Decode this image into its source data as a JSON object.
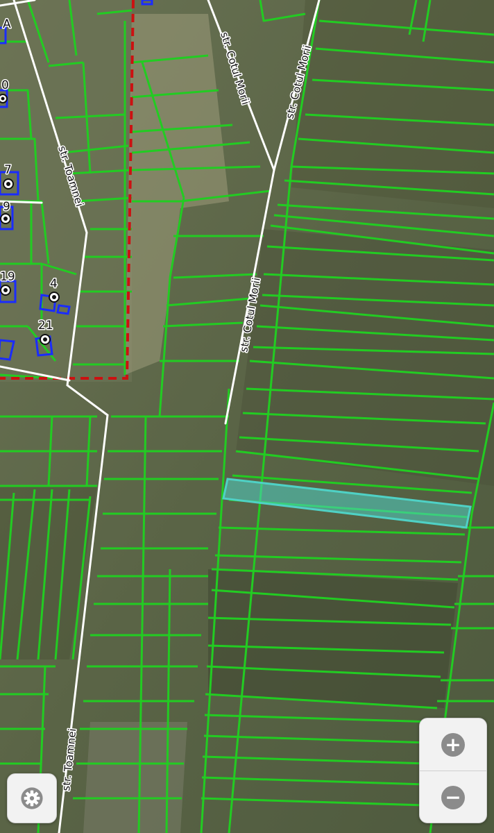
{
  "map": {
    "street_labels": {
      "toamnei_upper": "str. Toamnei",
      "toamnei_lower": "str. Toamnei",
      "cotul_morii_top_left": "str. Cotul Morii",
      "cotul_morii_top_right": "str. Cotul Morii",
      "cotul_morii_center": "str. Cotul Morii"
    },
    "house_numbers": {
      "a": "A",
      "n0": "0",
      "n7": "7",
      "n9": "9",
      "n19": "19",
      "n4": "4",
      "n21": "21"
    },
    "colors": {
      "parcel_outline": "#22cc22",
      "building_outline": "#1a2cff",
      "road": "#ffffff",
      "boundary_dashed": "#cc1111",
      "selected_parcel": "#4fd1c5"
    }
  },
  "controls": {
    "zoom_in_label": "+",
    "zoom_out_label": "−",
    "settings_icon": "gear-icon"
  }
}
